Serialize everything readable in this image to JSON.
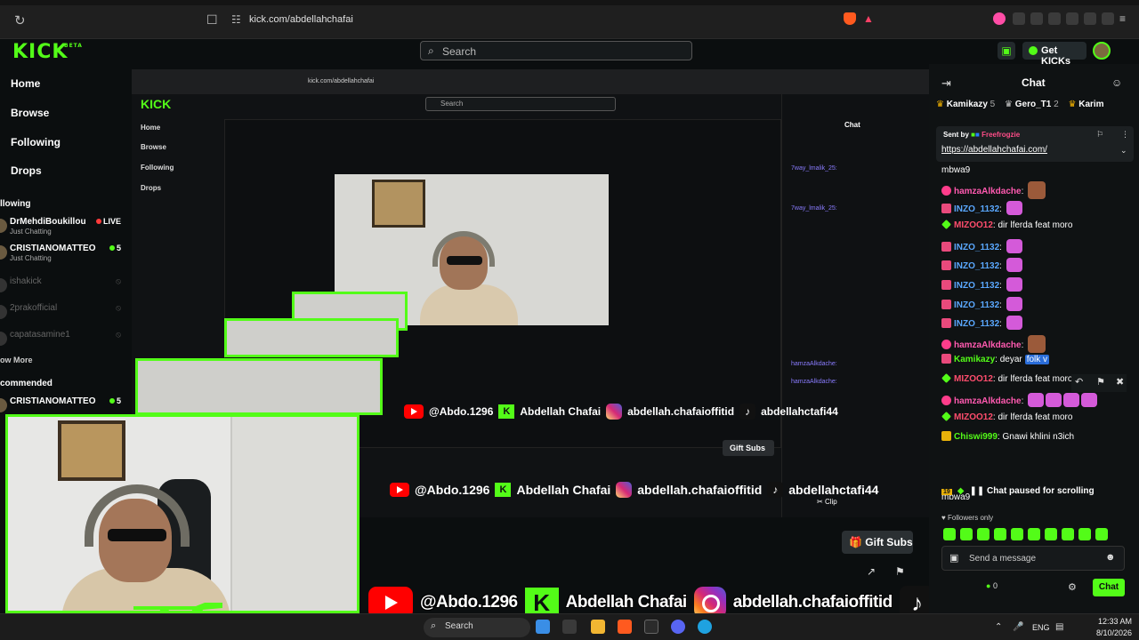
{
  "browser": {
    "url": "kick.com/abdellahchafai"
  },
  "header": {
    "logo": "KICK",
    "logo_tag": "BETA",
    "search_placeholder": "Search",
    "get_kicks": "Get KICKs"
  },
  "sidebar": {
    "nav": [
      {
        "label": "Home"
      },
      {
        "label": "Browse"
      },
      {
        "label": "Following"
      },
      {
        "label": "Drops"
      }
    ],
    "following_title": "llowing",
    "channels": [
      {
        "name": "DrMehdiBoukillou",
        "sub": "Just Chatting",
        "status": "LIVE"
      },
      {
        "name": "CRISTIANOMATTEO",
        "sub": "Just Chatting",
        "status": "5"
      },
      {
        "name": "ishakick"
      },
      {
        "name": "2prakofficial"
      },
      {
        "name": "capatasamine1"
      }
    ],
    "show_more": "ow More",
    "recommended_title": "commended",
    "recommended": [
      {
        "name": "CRISTIANOMATTEO",
        "status": "5"
      }
    ]
  },
  "stream": {
    "nested_url": "kick.com/abdellahchafai",
    "nested_search": "Search",
    "nested_chat_title": "Chat",
    "nested_gift": "Gift Subs",
    "strip_handle_yt": "@Abdo.1296",
    "strip_name_kick": "Abdellah Chafai",
    "strip_ig": "abdellah.chafaioffitid",
    "strip_tt": "abdellahctafi44",
    "nested_clip": "Clip"
  },
  "overlay": {
    "yt_handle": "@Abdo.1296",
    "kick_name": "Abdellah Chafai",
    "ig_handle": "abdellah.chafaioffitid",
    "tt_handle": "abdellahctafi44"
  },
  "controls": {
    "gift_subs": "Gift Subs"
  },
  "chat": {
    "title": "Chat",
    "gifters": [
      {
        "name": "Kamikazy",
        "count": "5"
      },
      {
        "name": "Gero_T1",
        "count": "2"
      },
      {
        "name": "Karim"
      }
    ],
    "pinned": {
      "sent_by": "Sent by",
      "sender": "Freefrogzie",
      "link": "https://abdellahchafai.com/",
      "tail": "mbwa9"
    },
    "messages": [
      {
        "user": "hamzaAlkdache",
        "color": "#ff5ab0",
        "badge": "pink",
        "text": "",
        "emotes": "face"
      },
      {
        "user": "INZO_1132",
        "color": "#5aa8ff",
        "badge": "gift",
        "text": "",
        "emotes": "1"
      },
      {
        "user": "MIZOO12",
        "color": "#ff4d6d",
        "badge": "green",
        "text": "dir lferda feat moro",
        "emotes": ""
      },
      {
        "user": "INZO_1132",
        "color": "#5aa8ff",
        "badge": "gift",
        "text": "",
        "emotes": "1"
      },
      {
        "user": "INZO_1132",
        "color": "#5aa8ff",
        "badge": "gift",
        "text": "",
        "emotes": "1"
      },
      {
        "user": "INZO_1132",
        "color": "#5aa8ff",
        "badge": "gift",
        "text": "",
        "emotes": "1"
      },
      {
        "user": "INZO_1132",
        "color": "#5aa8ff",
        "badge": "gift",
        "text": "",
        "emotes": "1"
      },
      {
        "user": "INZO_1132",
        "color": "#5aa8ff",
        "badge": "gift",
        "text": "",
        "emotes": "1"
      },
      {
        "user": "hamzaAlkdache",
        "color": "#ff5ab0",
        "badge": "pink",
        "text": "",
        "emotes": "face"
      },
      {
        "user": "Kamikazy",
        "color": "#53fc18",
        "badge": "gift",
        "text": "deyar",
        "highlight": "folk v"
      },
      {
        "user": "MIZOO12",
        "color": "#ff4d6d",
        "badge": "green",
        "text": "dir lferda feat moro",
        "emotes": ""
      },
      {
        "user": "hamzaAlkdache",
        "color": "#ff5ab0",
        "badge": "pink",
        "text": "",
        "emotes": "4"
      },
      {
        "user": "MIZOO12",
        "color": "#ff4d6d",
        "badge": "green",
        "text": "dir lferda feat moro",
        "emotes": ""
      },
      {
        "user": "Chiswi999",
        "color": "#53fc18",
        "badge": "gold",
        "text": "Gnawi khlini n3ich",
        "emotes": ""
      }
    ],
    "tail_text": "mbwa9",
    "paused": "Chat paused for scrolling",
    "followers_only": "Followers only",
    "send_placeholder": "Send a message",
    "kicks_count": "0",
    "chat_button": "Chat"
  },
  "taskbar": {
    "search": "Search",
    "lang": "ENG",
    "time": "12:33 AM",
    "date": "8/10/2026"
  }
}
